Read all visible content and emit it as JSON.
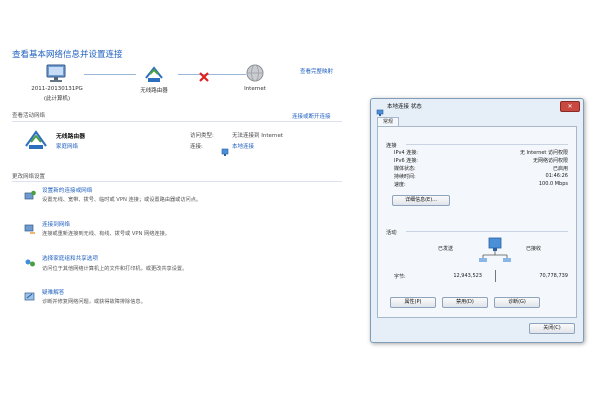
{
  "main": {
    "title": "查看基本网络信息并设置连接",
    "see_full_map": "查看完整映射",
    "map": {
      "computer_name": "2011-20130131PG",
      "computer_sub": "(此计算机)",
      "router": "无线路由器",
      "internet": "Internet"
    },
    "active_section": "查看活动网络",
    "connect_disconnect": "连接或断开连接",
    "network": {
      "name": "无线路由器",
      "type": "家庭网络",
      "access_type_label": "访问类型:",
      "access_type_value": "无法连接到 Internet",
      "connection_label": "连接:",
      "connection_value": "本地连接"
    },
    "change_section": "更改网络设置",
    "tasks": [
      {
        "title": "设置新的连接或网络",
        "desc": "设置无线、宽带、拨号、临时或 VPN 连接；或设置路由器或访问点。"
      },
      {
        "title": "连接到网络",
        "desc": "连接或重新连接到无线、有线、拨号或 VPN 网络连接。"
      },
      {
        "title": "选择家庭组和共享选项",
        "desc": "访问位于其他网络计算机上的文件和打印机，或更改共享设置。"
      },
      {
        "title": "疑难解答",
        "desc": "诊断并修复网络问题，或获得故障排除信息。"
      }
    ]
  },
  "dialog": {
    "title": "本地连接 状态",
    "close": "✕",
    "tab": "常规",
    "connection_group": "连接",
    "rows": [
      {
        "k": "IPv4 连接:",
        "v": "无 Internet 访问权限"
      },
      {
        "k": "IPv6 连接:",
        "v": "无网络访问权限"
      },
      {
        "k": "媒体状态:",
        "v": "已启用"
      },
      {
        "k": "持续时间:",
        "v": "01:46:26"
      },
      {
        "k": "速度:",
        "v": "100.0 Mbps"
      }
    ],
    "details_button": "详细信息(E)...",
    "activity_group": "活动",
    "sent_label": "已发送",
    "received_label": "已接收",
    "bytes_label": "字节:",
    "bytes_sent": "12,943,523",
    "bytes_received": "70,778,739",
    "properties_button": "属性(P)",
    "disable_button": "禁用(D)",
    "diagnose_button": "诊断(G)",
    "close_button": "关闭(C)"
  },
  "colors": {
    "link": "#1f5fbf",
    "accent": "#4a90d9",
    "error": "#e02020"
  }
}
